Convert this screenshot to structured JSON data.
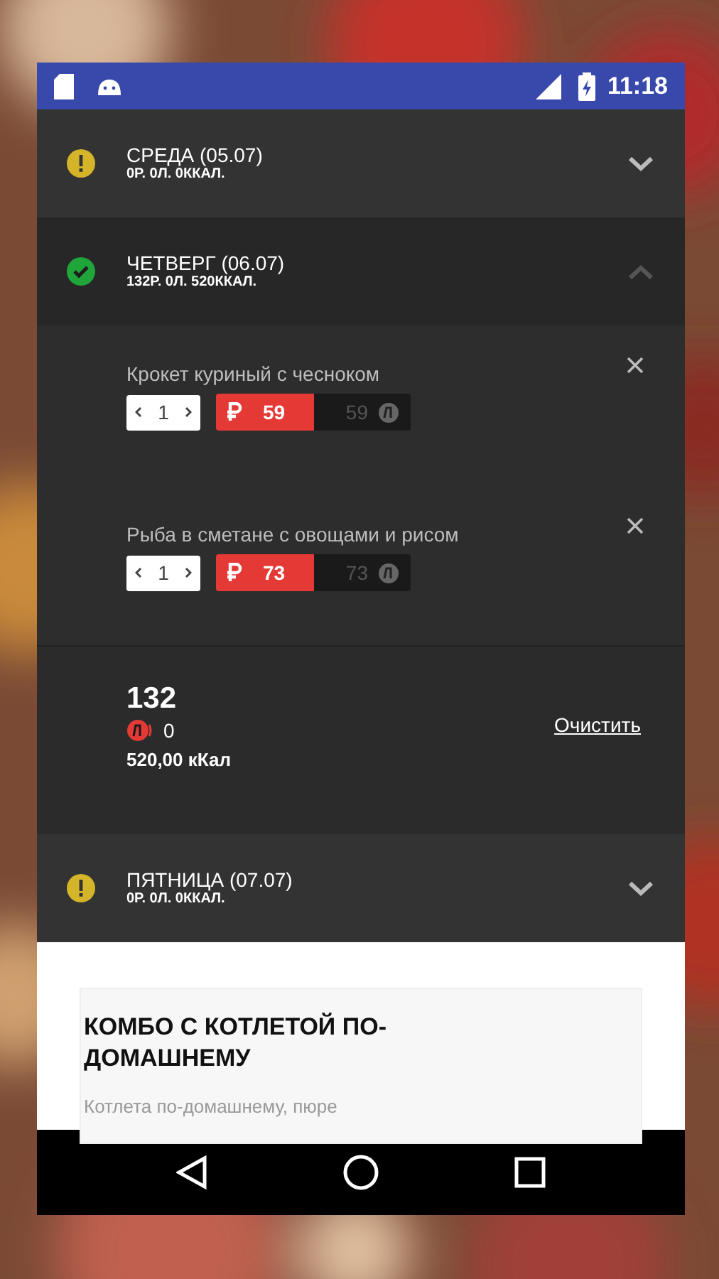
{
  "status_bar": {
    "time": "11:18"
  },
  "days": [
    {
      "title": "СРЕДА (05.07)",
      "summary": "0Р. 0Л. 0ККАЛ.",
      "complete": false,
      "expanded": false
    },
    {
      "title": "ЧЕТВЕРГ (06.07)",
      "summary": "132Р. 0Л. 520ККАЛ.",
      "complete": true,
      "expanded": true,
      "items": [
        {
          "name": "Крокет куриный с чесноком",
          "quantity": "1",
          "price": "59",
          "points": "59"
        },
        {
          "name": "Рыба в сметане с овощами и рисом",
          "quantity": "1",
          "price": "73",
          "points": "73"
        }
      ],
      "total": {
        "sum": "132",
        "points": "0",
        "calories": "520,00 кКал",
        "clear_link": "Очистить"
      }
    },
    {
      "title": "ПЯТНИЦА (07.07)",
      "summary": "0Р. 0Л. 0ККАЛ.",
      "complete": false,
      "expanded": false
    }
  ],
  "combo_card": {
    "title": "КОМБО С КОТЛЕТОЙ ПО-ДОМАШНЕМУ",
    "description": "Котлета по-домашнему, пюре"
  }
}
